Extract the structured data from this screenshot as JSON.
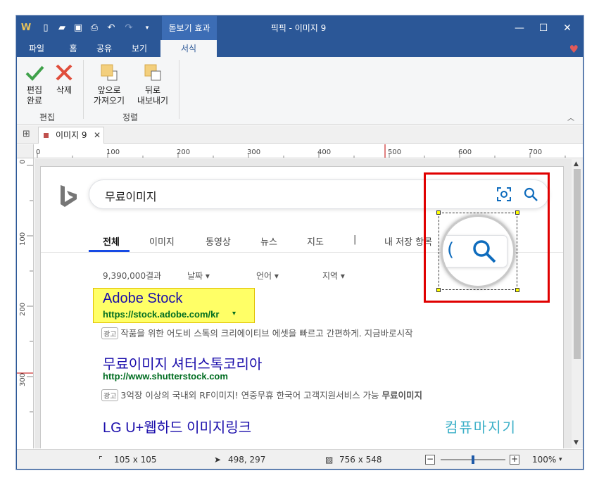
{
  "window": {
    "title": "픽픽 - 이미지 9",
    "context_tab": "돋보기 효과",
    "controls": {
      "minimize": "—",
      "maximize": "☐",
      "close": "✕"
    }
  },
  "ribbon_tabs": [
    {
      "label": "파일"
    },
    {
      "label": "홈"
    },
    {
      "label": "공유"
    },
    {
      "label": "보기"
    },
    {
      "label": "서식"
    }
  ],
  "ribbon": {
    "done_label": "편집\n완료",
    "delete_label": "삭제",
    "group_edit": "편집",
    "front_label": "앞으로\n가져오기",
    "back_label": "뒤로\n내보내기",
    "group_arrange": "정렬"
  },
  "doc_tab": {
    "label": "이미지 9"
  },
  "ruler_h": [
    "0",
    "100",
    "200",
    "300",
    "400",
    "500",
    "600",
    "700"
  ],
  "ruler_v": [
    "0",
    "100",
    "200",
    "300"
  ],
  "bing": {
    "query": "무료이미지",
    "nav": [
      "전체",
      "이미지",
      "동영상",
      "뉴스",
      "지도",
      "|",
      "내 저장 항목"
    ],
    "result_count": "9,390,000결과",
    "filters": [
      "날짜",
      "언어",
      "지역"
    ],
    "results": [
      {
        "title": "Adobe Stock",
        "url": "https://stock.adobe.com/kr",
        "ad": "광고",
        "desc": "작품을 위한 어도비 스톡의 크리에이티브 에셋을 빠르고 간편하게. 지금바로시작"
      },
      {
        "title": "무료이미지 셔터스톡코리아",
        "url": "http://www.shutterstock.com",
        "ad": "광고",
        "desc": "3억장 이상의 국내외 RF이미지! 연중무휴 한국어 고객지원서비스 가능 ",
        "desc_bold": "무료이미지"
      },
      {
        "title": "LG U+웹하드 이미지링크"
      }
    ],
    "watermark": "컴퓨마지기"
  },
  "status": {
    "selection_size": "105 x 105",
    "cursor_pos": "498, 297",
    "image_size": "756 x 548",
    "zoom": "100%",
    "zoom_level": 0.5
  },
  "colors": {
    "title_bar": "#2b5797",
    "highlight_box": "#ffff66",
    "annotation_red": "#e00000",
    "link_blue": "#1a0dab",
    "url_green": "#006d21"
  }
}
